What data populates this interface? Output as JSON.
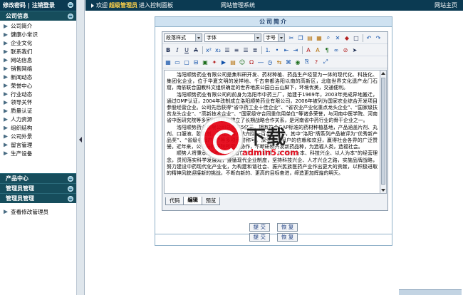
{
  "sidebar": {
    "top_links": {
      "change_password": "修改密码",
      "logout": "注销登录"
    },
    "sections": [
      {
        "title": "公司信息",
        "items": [
          "公司简介",
          "健康小常识",
          "企业文化",
          "联系我们",
          "网站信息",
          "销售网络",
          "新闻动态",
          "荣誉中心",
          "行业动态",
          "领导关怀",
          "质量认证",
          "人力资源",
          "组织结构",
          "公司外景",
          "留言管理",
          "生产设备"
        ]
      },
      {
        "title": "产品中心",
        "items": []
      },
      {
        "title": "管理员管理",
        "items": []
      },
      {
        "title": "管理员管理",
        "items": [
          "查看修改管理员"
        ]
      }
    ]
  },
  "topbar": {
    "welcome": "欢迎",
    "username": "超级管理员",
    "enter": "进入控制面板",
    "center": "网站管理系统",
    "right": "网站主页"
  },
  "editor": {
    "title": "公司简介",
    "selects": {
      "style": "段落样式",
      "font": "字体",
      "size": "字号"
    },
    "content": [
      "洛阳顺势药业有限公司是集科研开发、药材种植、药品生产经营为一体的现代化、科技化、集团化企业，位于华夏文明的发祥地、千古帝都洛阳以南的高新区，北临世界文化遗产龙门石窟，南依联合国教科文组织确定的世界地质公园白云山脚下，环境优美，交通便利。",
      "洛阳顺势药业有限公司的前身为洛阳市中药三厂，始建于1969年，2003年完成异地搬迁，通过GMP认证，2004年改制成立洛阳顺势药业有限公司，2006年被列为国家农业综合开发项目参股经营企业。公司先后获得“省中药工业十佳企业”、“省农业产业化重点龙头企业”、“国家级扶贫龙头企业”、“高新技术企业”、“国家级守合同重信用单位”等诸多荣誉，与河南中医学院、河南省中医研究院等多家科研机构建立了长期战略合作关系，是河南省中药行业的骨干企业之一。",
      "洛阳顺势药业有限公司总资产5亿元，拥有符合GAP标准的药材种植基地，产品涵盖片剂、丸剂、口服液、胶囊剂、颗粒剂等八大剂型一百余个品种，其中“洛阳”牌系列产品被评为“优秀新产品奖”、“省级名牌产品”等多项荣誉称号，深受广大用户的信赖和欢迎，赢得社会各界的广泛赞誉。近年来，公司与科研院所密切协作，不断研制开发新药品种，为造福人类，造福社会。",
      "顺势人将秉承“顺者昌、逆者亡”的企业精神，以“诚信为本、科技兴企、以人为本”的经营理念，贯彻落实科学发展观，遵循现代企业制度，坚持科技兴企、人才兴企之路，实施品牌战略，努力建设中药现代化产业化，为构建和谐社会、振兴民族医药产业作出更大的贡献，以积极进取的精神风貌迎接新的挑战，不断向新的、更高的目标奋进，缔造更加辉煌的明天。"
    ],
    "tabs": [
      "代码",
      "编辑",
      "预览"
    ],
    "buttons": {
      "submit": "提 交",
      "reset": "恢 复"
    }
  },
  "watermark": {
    "cn": "下载",
    "url": "admin5.com"
  },
  "colors": {
    "nav_dark": "#0b3a52",
    "section_header": "#164d5c",
    "frame_border": "#8fb0c8",
    "accent_red": "#e40012"
  }
}
